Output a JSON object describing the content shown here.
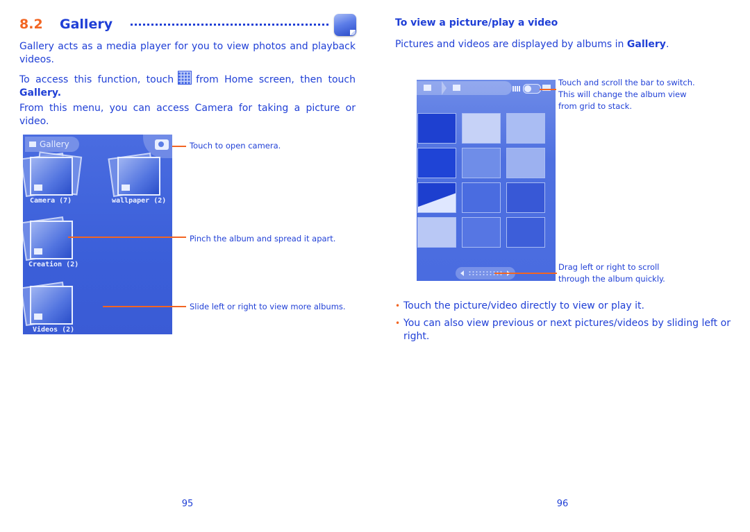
{
  "left_page": {
    "section": {
      "number": "8.2",
      "title": "Gallery",
      "icon": "gallery-app-icon"
    },
    "intro": "Gallery acts as a media player for you to view photos and playback videos.",
    "access": {
      "before": "To access this function, touch",
      "icon": "app-grid-icon",
      "after": "from Home screen, then touch",
      "target": "Gallery."
    },
    "menu_note": "From this menu, you can access Camera for taking a picture or video.",
    "screenshot": {
      "header_label": "Gallery",
      "albums": [
        {
          "name": "Camera",
          "count": "(7)",
          "label": "Camera (7)"
        },
        {
          "name": "wallpaper",
          "count": "(2)",
          "label": "wallpaper (2)"
        },
        {
          "name": "Creation",
          "count": "(2)",
          "label": "Creation (2)"
        },
        {
          "name": "Videos",
          "count": "(2)",
          "label": "Videos (2)"
        }
      ]
    },
    "callouts": [
      "Touch to open camera.",
      "Pinch the album and spread it apart.",
      "Slide left or right to view more albums."
    ],
    "page_number": "95"
  },
  "right_page": {
    "subheading": "To view a picture/play a video",
    "intro_before": "Pictures and videos are displayed by albums in",
    "intro_bold": "Gallery",
    "intro_after": ".",
    "callouts": [
      "Touch and scroll the bar to switch. This will change the album view from grid to stack.",
      "Drag left or right to scroll through the album quickly."
    ],
    "bullets": [
      "Touch the picture/video directly to view or play it.",
      "You can also view previous or next pictures/videos by sliding left or right."
    ],
    "page_number": "96"
  },
  "colors": {
    "text_blue": "#1f3fd6",
    "accent_orange": "#f26522",
    "screen_blue": "#4a6ce0"
  }
}
